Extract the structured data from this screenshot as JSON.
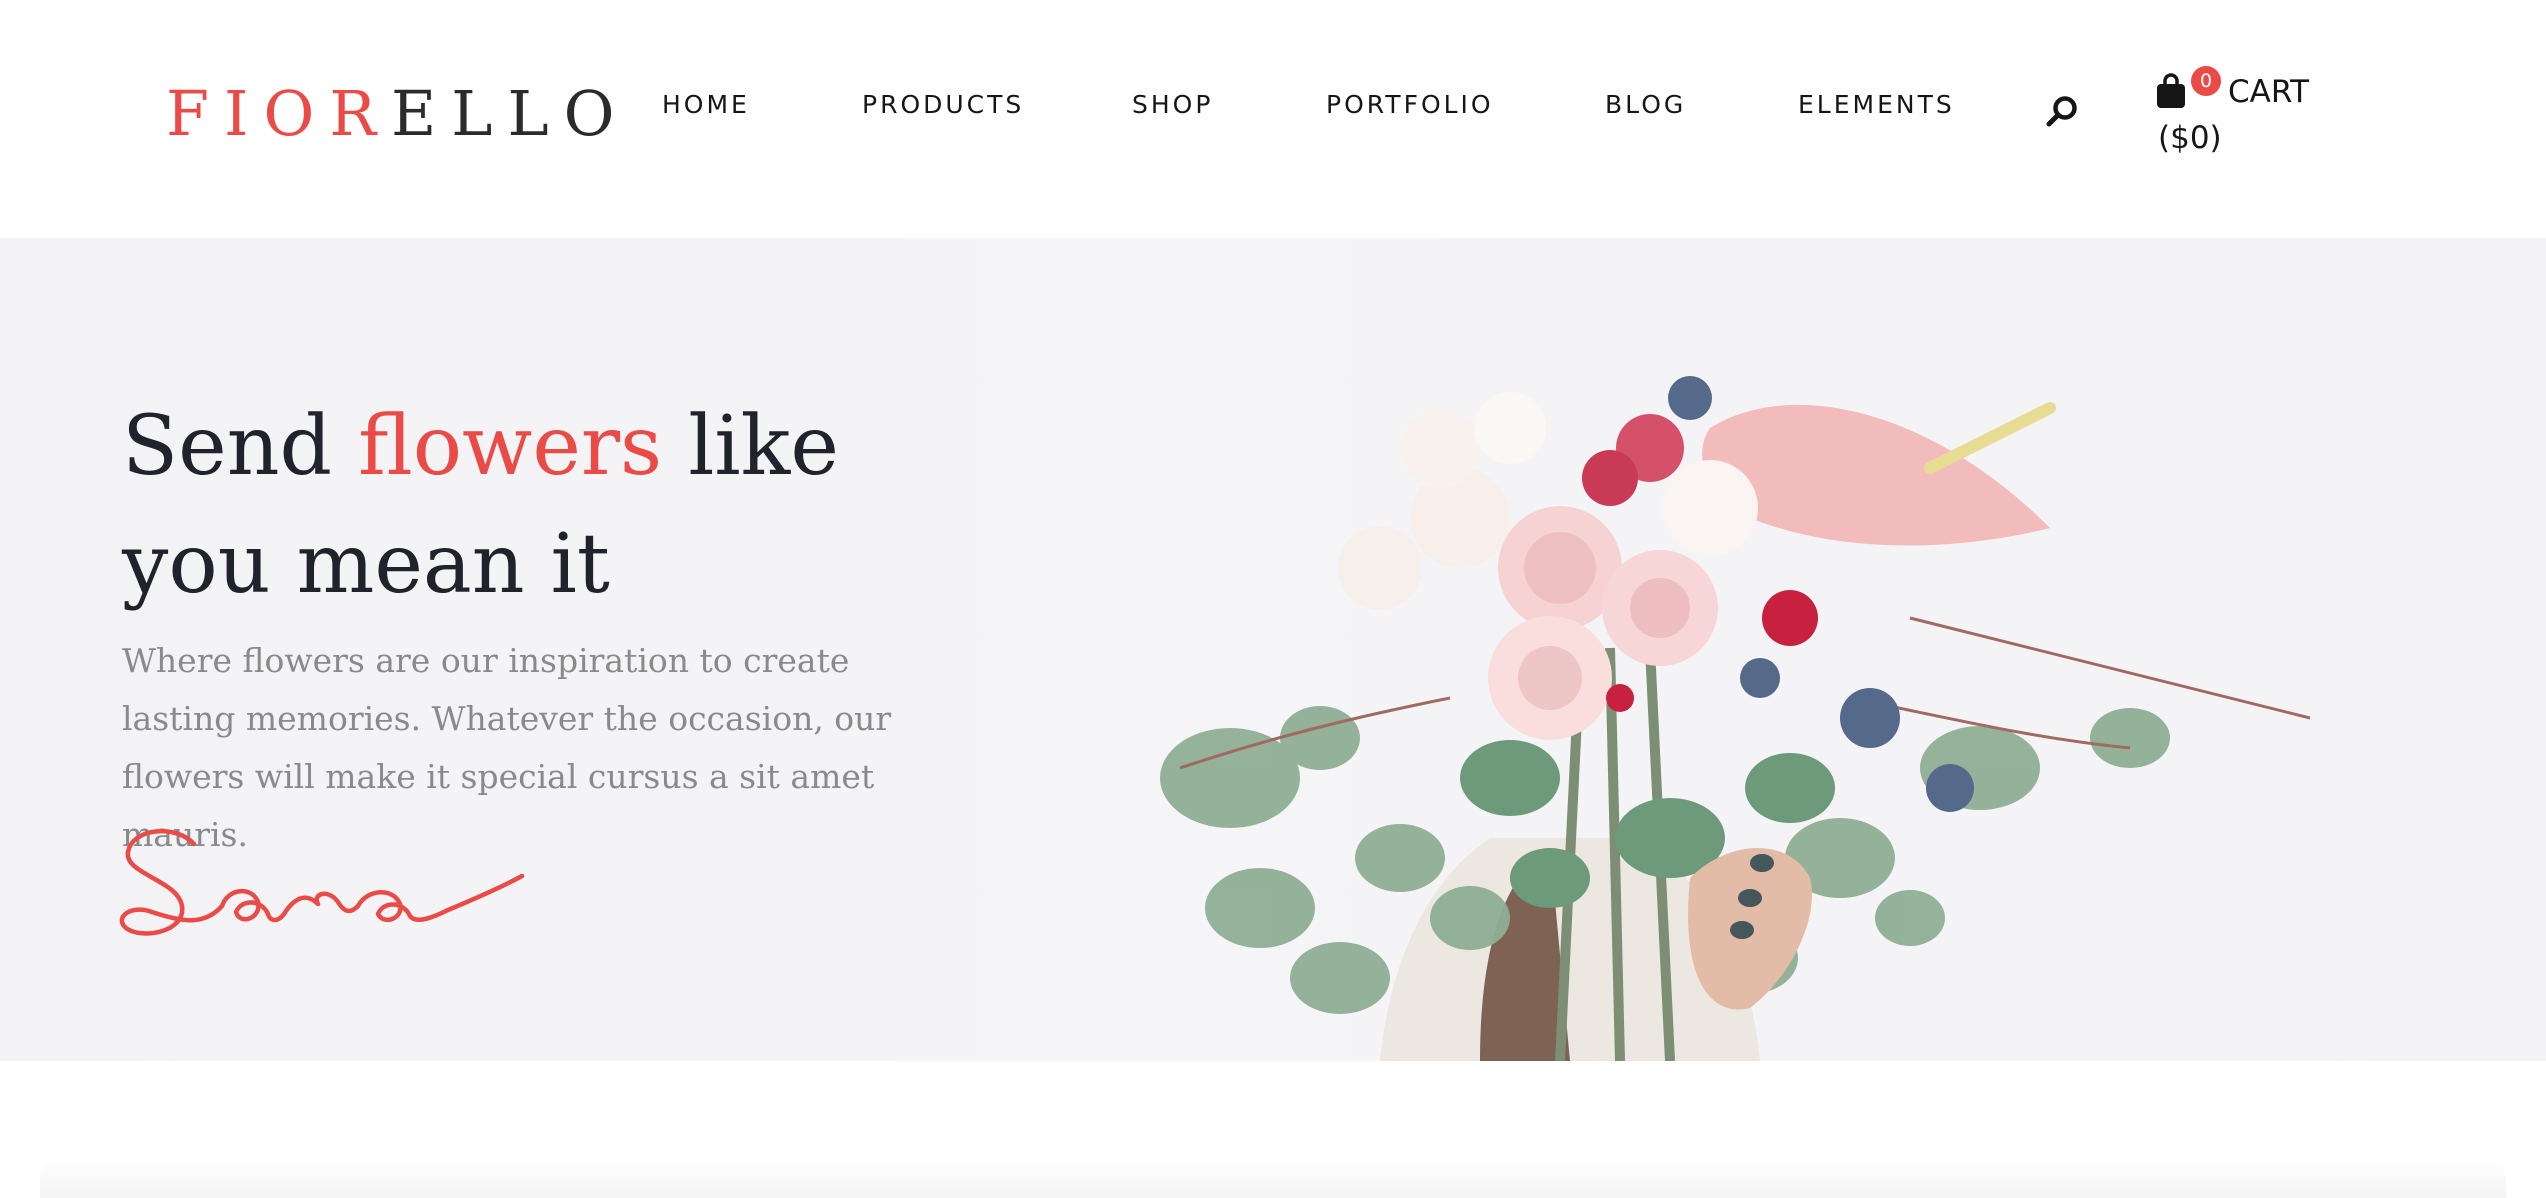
{
  "brand": {
    "logo_accent": "FIOR",
    "logo_rest": "ELLO",
    "accent_color": "#ea4b47"
  },
  "nav": {
    "items": [
      {
        "label": "HOME"
      },
      {
        "label": "PRODUCTS"
      },
      {
        "label": "SHOP"
      },
      {
        "label": "PORTFOLIO"
      },
      {
        "label": "BLOG"
      },
      {
        "label": "ELEMENTS"
      }
    ],
    "search_icon": "search-icon"
  },
  "cart": {
    "icon": "shopping-bag-icon",
    "count": "0",
    "label": "CART",
    "total": "($0)"
  },
  "hero": {
    "title_part1": "Send ",
    "title_highlight": "flowers",
    "title_part2": " like",
    "title_line2": "you mean it",
    "description": "Where flowers are our inspiration to create lasting memories. Whatever the occasion, our flowers will make it special cursus a sit amet mauris.",
    "signature": "Sara"
  }
}
